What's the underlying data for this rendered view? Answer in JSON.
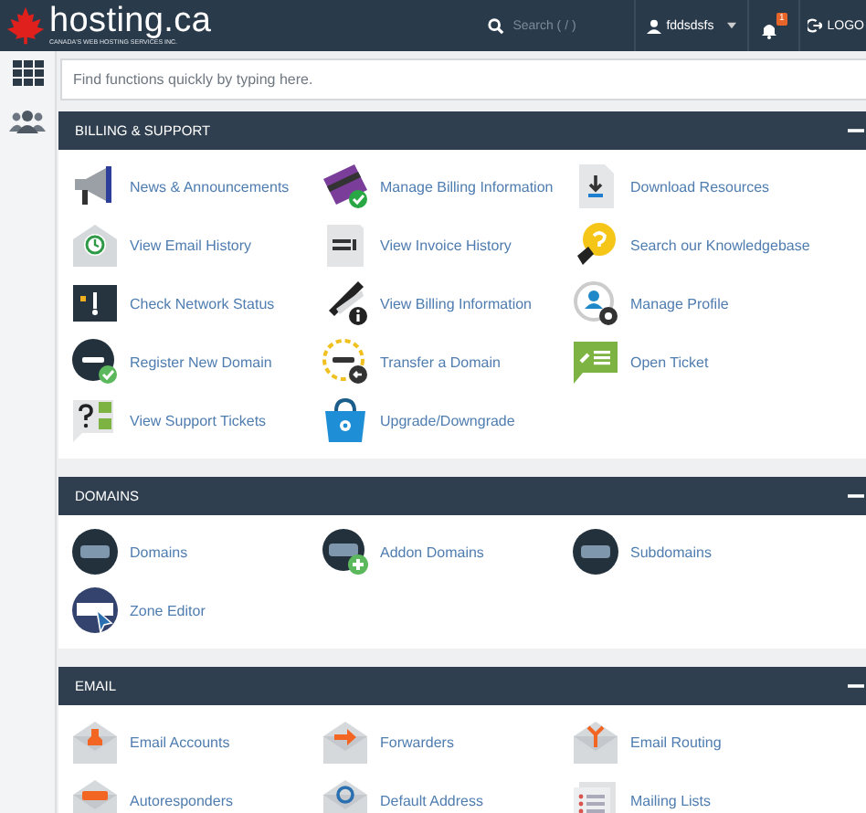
{
  "header": {
    "brand": "hosting.ca",
    "tagline": "CANADA'S WEB HOSTING SERVICES INC.",
    "search": {
      "placeholder": "Search ( / )"
    },
    "user": "fddsdsfs",
    "notifications": "1",
    "logout": "LOGO"
  },
  "quick_find": {
    "placeholder": "Find functions quickly by typing here."
  },
  "sections": [
    {
      "title": "BILLING & SUPPORT",
      "expanded": true,
      "items": [
        "News & Announcements",
        "Manage Billing Information",
        "Download Resources",
        "View Email History",
        "View Invoice History",
        "Search our Knowledgebase",
        "Check Network Status",
        "View Billing Information",
        "Manage Profile",
        "Register New Domain",
        "Transfer a Domain",
        "Open Ticket",
        "View Support Tickets",
        "Upgrade/Downgrade"
      ]
    },
    {
      "title": "DOMAINS",
      "expanded": true,
      "items": [
        "Domains",
        "Addon Domains",
        "Subdomains",
        "Zone Editor"
      ]
    },
    {
      "title": "EMAIL",
      "expanded": true,
      "items": [
        "Email Accounts",
        "Forwarders",
        "Email Routing",
        "Autoresponders",
        "Default Address",
        "Mailing Lists"
      ]
    }
  ]
}
